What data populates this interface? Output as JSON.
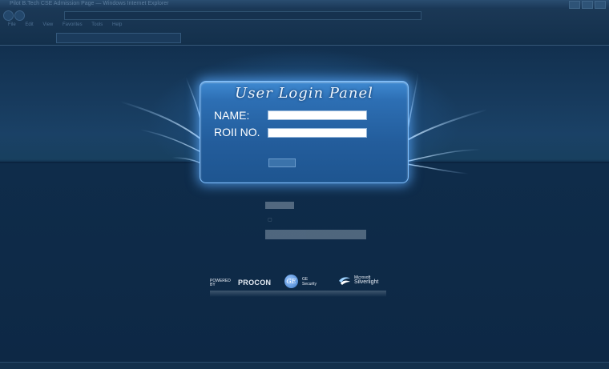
{
  "window": {
    "title": "Pilot B.Tech CSE Admission Page — Windows Internet Explorer"
  },
  "browser": {
    "menu": [
      "File",
      "Edit",
      "View",
      "Favorites",
      "Tools",
      "Help"
    ]
  },
  "panel": {
    "title": "User Login Panel",
    "name_label": "NAME:",
    "roll_label": "ROII NO.",
    "name_value": "",
    "roll_value": ""
  },
  "logos": {
    "procon_powered": "POWERED BY",
    "procon_name": "PROCON",
    "ge_mark": "GE",
    "ge_line1": "GE",
    "ge_line2": "Security",
    "silverlight_prefix": "Microsoft",
    "silverlight_name": "Silverlight"
  },
  "colors": {
    "accent": "#3f8ad2",
    "background": "#0f2a45",
    "panel_glow": "#5aaaff"
  }
}
